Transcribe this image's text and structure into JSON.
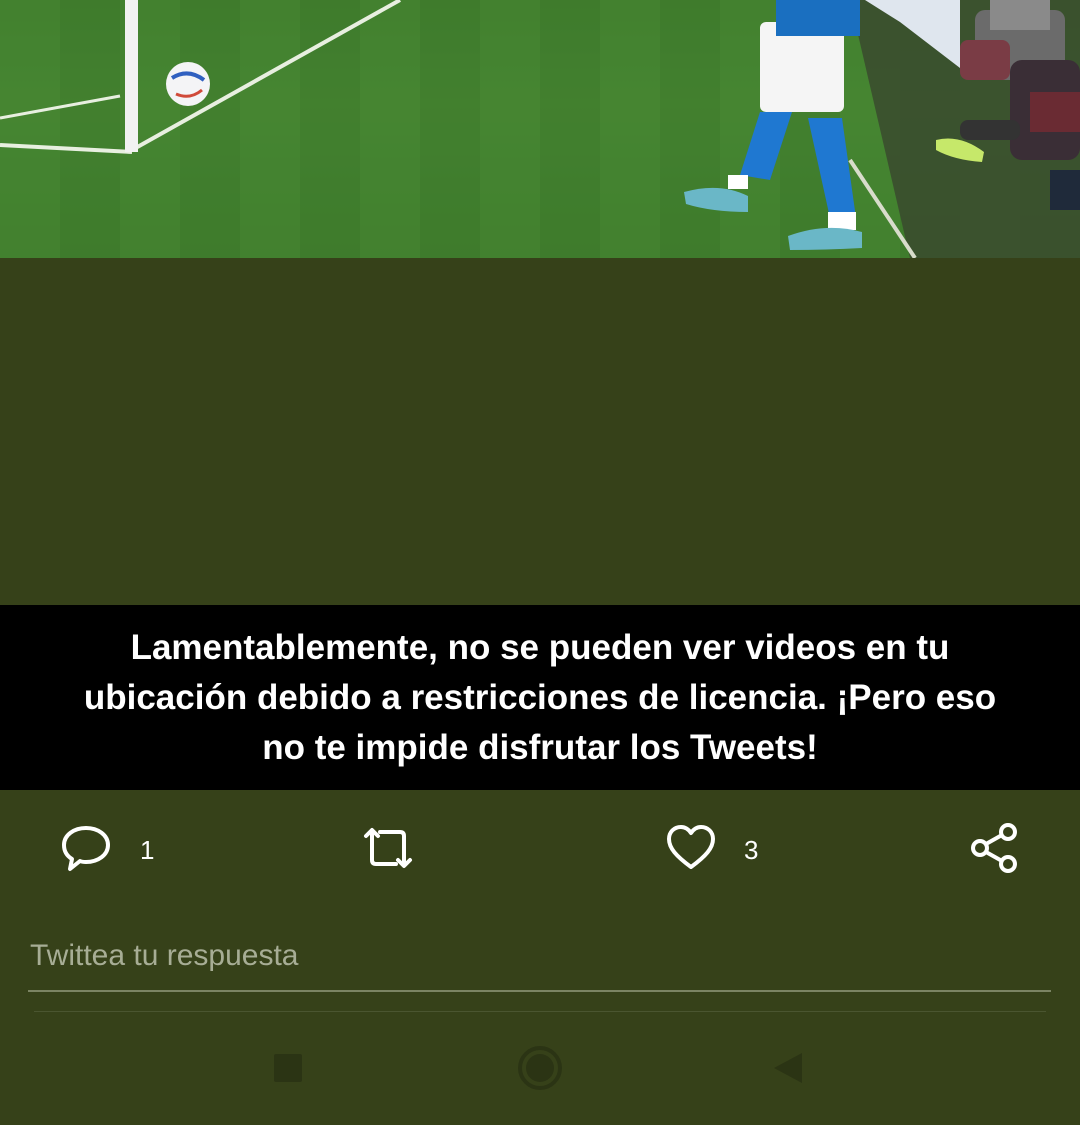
{
  "notice": {
    "line1": "Lamentablemente, no se pueden ver videos en tu",
    "line2": "ubicación debido a restricciones de licencia. ¡Pero eso",
    "line3": "no te impide disfrutar los Tweets!"
  },
  "actions": {
    "reply": {
      "icon": "reply-icon",
      "count": "1"
    },
    "retweet": {
      "icon": "retweet-icon"
    },
    "like": {
      "icon": "heart-icon",
      "count": "3"
    },
    "share": {
      "icon": "share-icon"
    }
  },
  "reply_box": {
    "placeholder": "Twittea tu respuesta"
  },
  "nav": {
    "recents": "square-icon",
    "home": "circle-icon",
    "back": "triangle-back-icon"
  },
  "colors": {
    "background": "#364119",
    "notice_bg": "#000000",
    "text": "#ffffff",
    "placeholder": "#a7ad95"
  }
}
